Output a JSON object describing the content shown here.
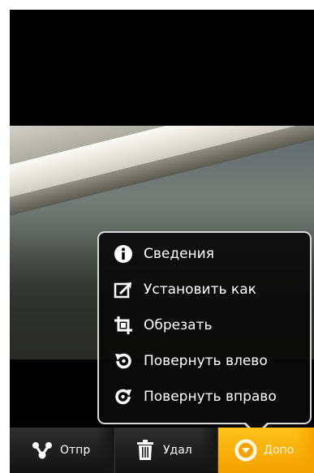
{
  "menu": {
    "items": [
      {
        "label": "Сведения",
        "icon": "info-icon"
      },
      {
        "label": "Установить как",
        "icon": "set-as-icon"
      },
      {
        "label": "Обрезать",
        "icon": "crop-icon"
      },
      {
        "label": "Повернуть влево",
        "icon": "rotate-left-icon"
      },
      {
        "label": "Повернуть вправо",
        "icon": "rotate-right-icon"
      }
    ]
  },
  "actionbar": {
    "share_label": "Отпр",
    "delete_label": "Удал",
    "more_label": "Допо"
  },
  "colors": {
    "accent": "#f3a000",
    "menu_border": "#d8d8d8",
    "background": "#000000"
  }
}
